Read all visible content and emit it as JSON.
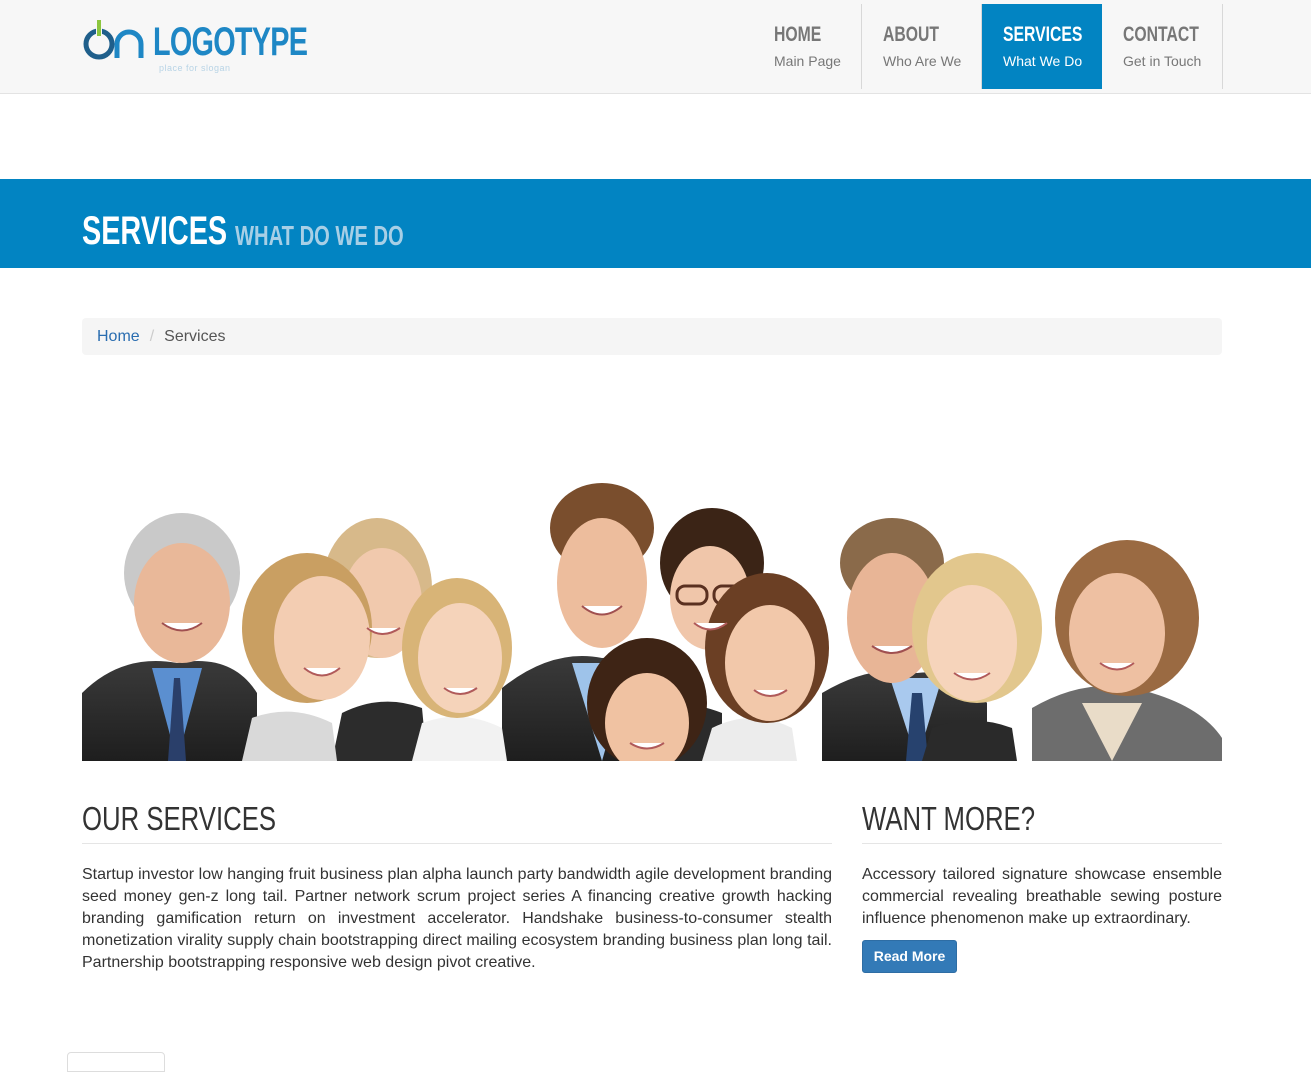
{
  "header": {
    "logo_text": "LOGOTYPE",
    "logo_slogan": "place for slogan",
    "nav": [
      {
        "title": "HOME",
        "sub": "Main Page"
      },
      {
        "title": "ABOUT",
        "sub": "Who Are We"
      },
      {
        "title": "SERVICES",
        "sub": "What We Do"
      },
      {
        "title": "CONTACT",
        "sub": "Get in Touch"
      }
    ]
  },
  "band": {
    "title": "SERVICES",
    "subtitle": "WHAT DO WE DO"
  },
  "breadcrumb": {
    "home": "Home",
    "separator": "/",
    "current": "Services"
  },
  "hero": {
    "alt": "Group of smiling business people"
  },
  "services": {
    "title": "OUR SERVICES",
    "text": "Startup investor low hanging fruit business plan alpha launch party bandwidth agile development branding seed money gen-z long tail. Partner network scrum project series A financing creative growth hacking branding gamification return on investment accelerator. Handshake business-to-consumer stealth monetization virality supply chain bootstrapping direct mailing ecosystem branding business plan long tail. Partnership bootstrapping responsive web design pivot creative."
  },
  "more": {
    "title": "WANT MORE?",
    "text": "Accessory tailored signature showcase ensemble commercial revealing breathable sewing posture influence phenomenon make up extraordinary.",
    "button": "Read More"
  },
  "colors": {
    "brand": "#0284c2",
    "link": "#2a6db0",
    "button": "#337ab7"
  }
}
